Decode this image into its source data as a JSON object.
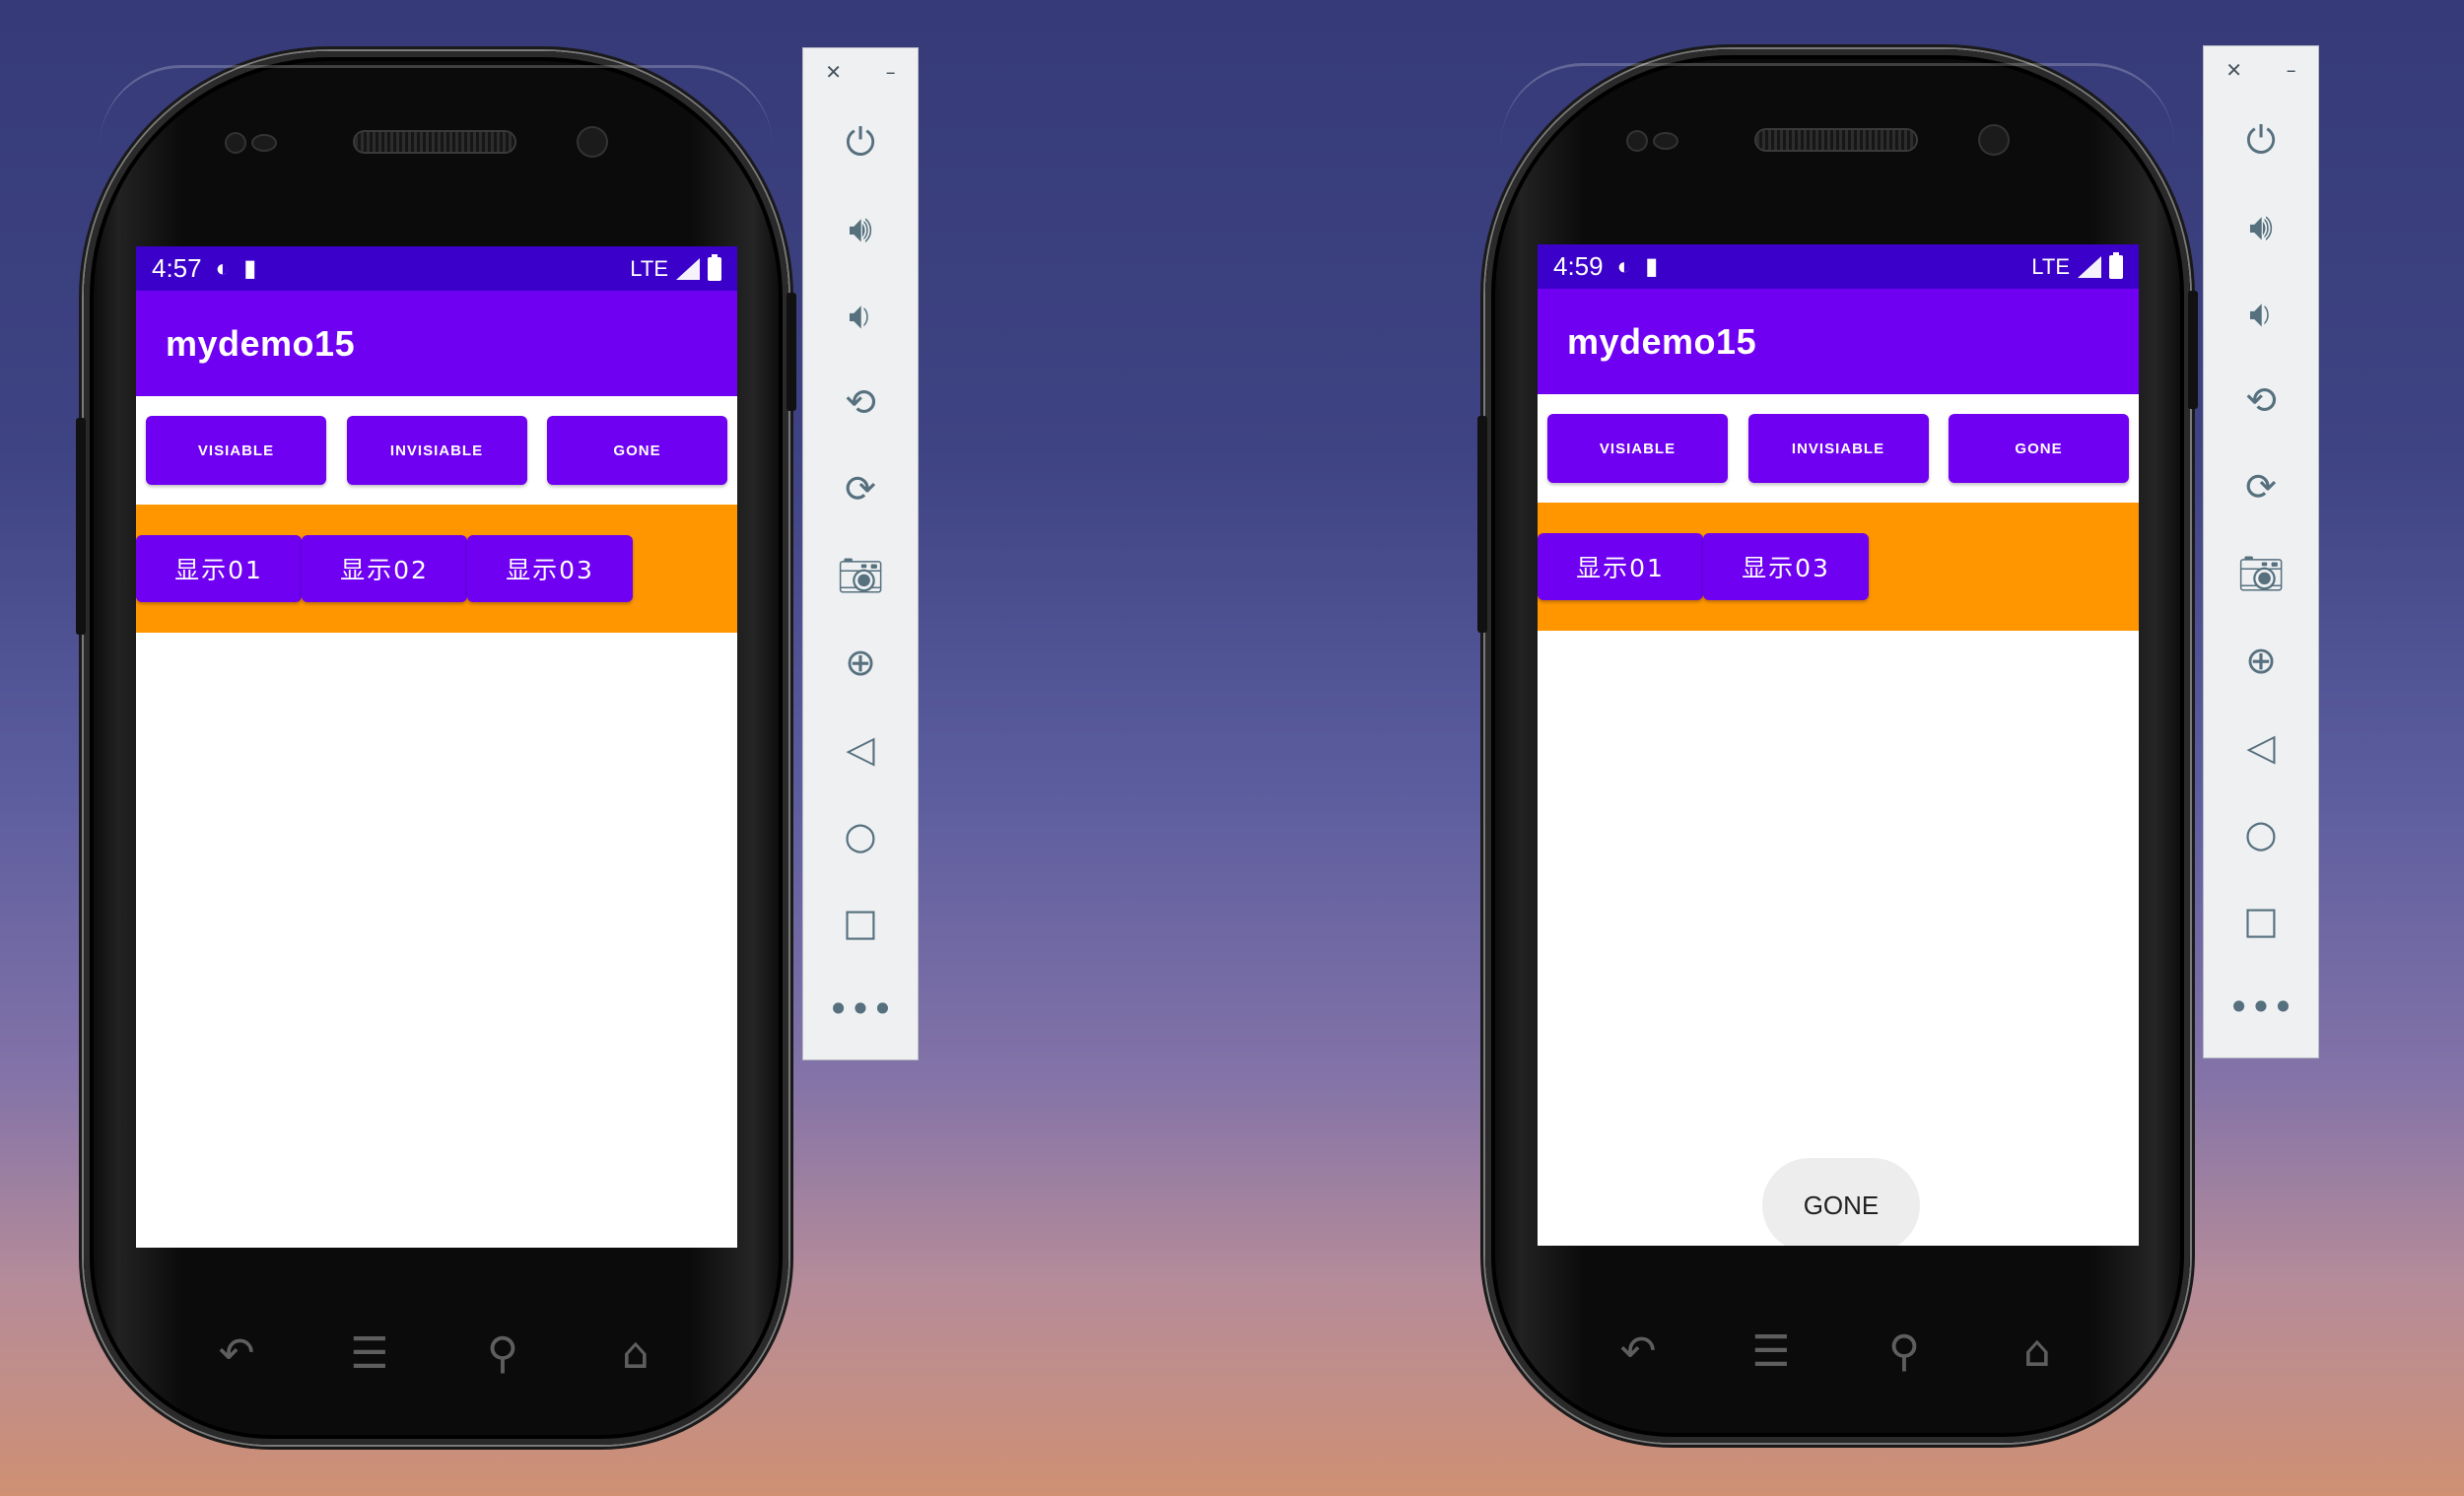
{
  "emulators": [
    {
      "status_time": "4:57",
      "status_network": "LTE",
      "app_title": "mydemo15",
      "top_buttons": [
        "VISIABLE",
        "INVISIABLE",
        "GONE"
      ],
      "show_buttons": [
        "显示01",
        "显示02",
        "显示03"
      ],
      "toast": ""
    },
    {
      "status_time": "4:59",
      "status_network": "LTE",
      "app_title": "mydemo15",
      "top_buttons": [
        "VISIABLE",
        "INVISIABLE",
        "GONE"
      ],
      "show_buttons": [
        "显示01",
        "显示03"
      ],
      "toast": "GONE"
    }
  ],
  "toolbar": {
    "window_controls": [
      "close-icon",
      "minimize-icon"
    ],
    "icons": [
      "power-icon",
      "volume-up-icon",
      "volume-down-icon",
      "rotate-left-icon",
      "rotate-right-icon",
      "camera-icon",
      "zoom-icon",
      "back-icon",
      "home-icon",
      "overview-icon",
      "more-icon"
    ]
  },
  "colors": {
    "status_bar": "#3b00c9",
    "app_bar": "#6f00f2",
    "button": "#6f00f2",
    "container": "#ff9600",
    "toast_bg": "#ededed"
  }
}
